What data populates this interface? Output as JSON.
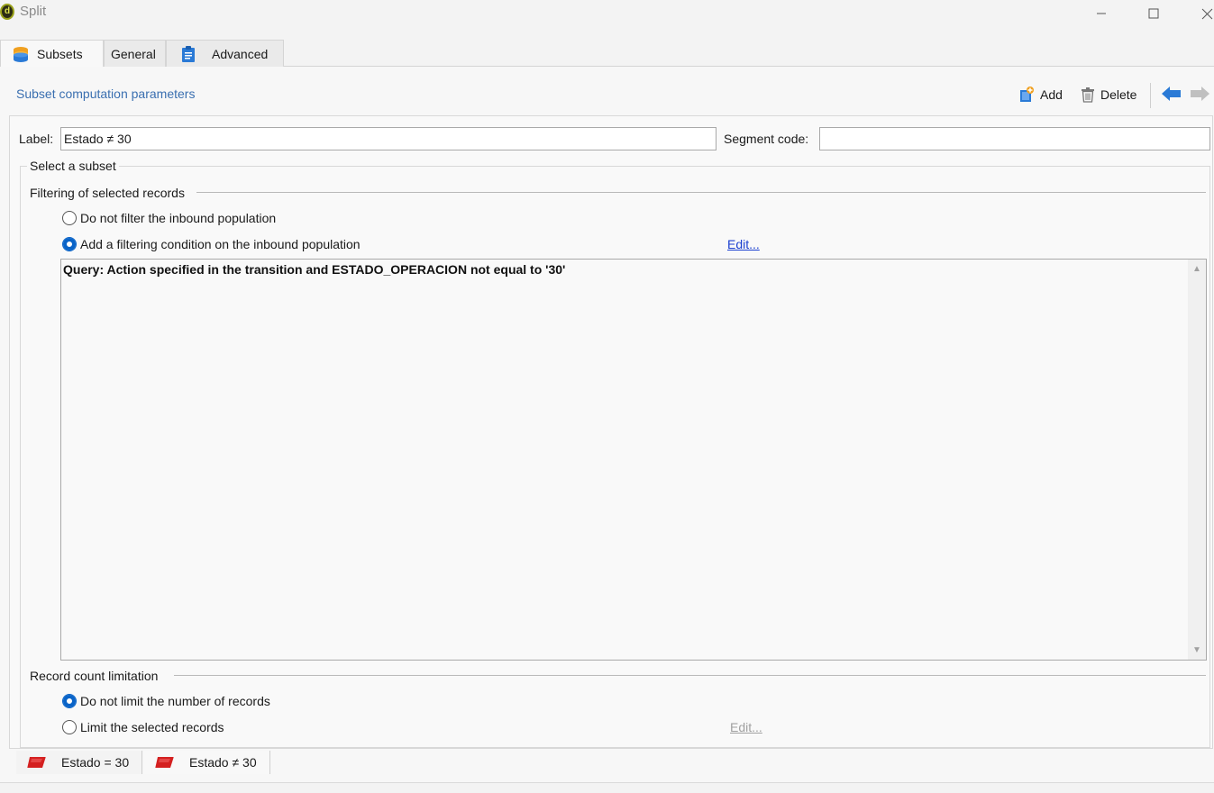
{
  "window": {
    "title": "Split",
    "app_icon_glyph": "d",
    "icons": [
      "minimize-icon",
      "maximize-icon",
      "close-icon"
    ]
  },
  "tabs": [
    {
      "label": "Subsets",
      "icon": "database-icon",
      "active": true
    },
    {
      "label": "General",
      "icon": null,
      "active": false
    },
    {
      "label": "Advanced",
      "icon": "clipboard-icon",
      "active": false
    }
  ],
  "section": {
    "title": "Subset computation parameters"
  },
  "toolbar": {
    "add_label": "Add",
    "delete_label": "Delete"
  },
  "form": {
    "label_caption": "Label:",
    "label_value": "Estado ≠ 30",
    "segment_caption": "Segment code:",
    "segment_value": ""
  },
  "select_subset": {
    "legend": "Select a subset",
    "filtering": {
      "heading": "Filtering of selected records",
      "options": [
        {
          "label": "Do not filter the inbound population",
          "selected": false
        },
        {
          "label": "Add a filtering condition on the inbound population",
          "selected": true
        }
      ],
      "edit_link": "Edit...",
      "query": "Query: Action specified in the transition and ESTADO_OPERACION not equal to '30'"
    },
    "limitation": {
      "heading": "Record count limitation",
      "options": [
        {
          "label": "Do not limit the number of records",
          "selected": true
        },
        {
          "label": "Limit the selected records",
          "selected": false
        }
      ],
      "edit_link": "Edit..."
    }
  },
  "bottom_tabs": [
    {
      "label": "Estado = 30",
      "icon": "subset-shape-icon",
      "color": "#d42020"
    },
    {
      "label": "Estado ≠ 30",
      "icon": "subset-shape-icon",
      "color": "#d42020"
    }
  ],
  "colors": {
    "accent_link": "#3a6fb0",
    "radio_selected": "#0a64c8",
    "nav_arrow_active": "#2a7ad6",
    "nav_arrow_inactive": "#b8b8b8"
  }
}
